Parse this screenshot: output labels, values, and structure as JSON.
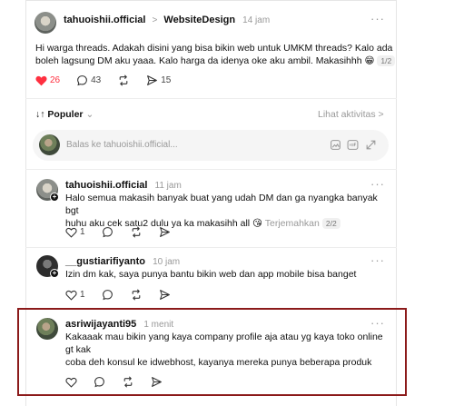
{
  "post": {
    "username": "tahuoishii.official",
    "separator": ">",
    "community": "WebsiteDesign",
    "time": "14 jam",
    "more": "···",
    "text_line1": "Hi warga threads. Adakah disini yang bisa bikin web untuk UMKM threads? Kalo ada",
    "text_line2": "boleh lagsung DM aku yaaa. Kalo harga da idenya oke aku ambil. Makasihhh 😁",
    "page_badge": "1/2",
    "likes": "26",
    "comments": "43",
    "shares": "15"
  },
  "sort": {
    "label": "↓↑ Populer",
    "chevron": "⌄",
    "activity_link": "Lihat aktivitas >"
  },
  "reply_input": {
    "placeholder": "Balas ke tahuoishii.official..."
  },
  "replies": [
    {
      "username": "tahuoishii.official",
      "time": "11 jam",
      "line1": "Halo semua makasih banyak buat yang udah DM dan ga nyangka banyak bgt",
      "line2": "huhu aku cek satu2 dulu ya ka makasihh all 😘",
      "translate": "Terjemahkan",
      "page_badge": "2/2",
      "likes": "1"
    },
    {
      "username": "__gustiarifiyanto",
      "time": "10 jam",
      "line1": "Izin dm kak, saya punya bantu bikin web dan app mobile bisa banget",
      "likes": "1"
    },
    {
      "username": "asriwijayanti95",
      "time": "1 menit",
      "line1": "Kakaaak mau bikin yang kaya company profile aja atau yg kaya toko online",
      "line2": "gt kak",
      "line3": "coba deh konsul ke idwebhost, kayanya mereka punya beberapa produk"
    }
  ],
  "colors": {
    "heart": "#ff3040",
    "highlight_border": "#8b1a1a",
    "muted": "#999999"
  },
  "icons": [
    "heart-icon",
    "comment-icon",
    "repost-icon",
    "share-icon",
    "gif-icon",
    "image-icon",
    "expand-icon"
  ]
}
